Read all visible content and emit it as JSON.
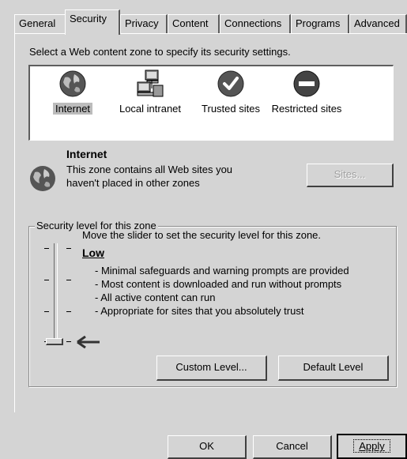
{
  "tabs": [
    "General",
    "Security",
    "Privacy",
    "Content",
    "Connections",
    "Programs",
    "Advanced"
  ],
  "active_tab": "Security",
  "zone_prompt": "Select a Web content zone to specify its security settings.",
  "zones": [
    {
      "label": "Internet",
      "icon": "globe-icon",
      "selected": true
    },
    {
      "label": "Local intranet",
      "icon": "intranet-computers-icon",
      "selected": false
    },
    {
      "label": "Trusted sites",
      "icon": "checkmark-icon",
      "selected": false
    },
    {
      "label": "Restricted sites",
      "icon": "no-entry-icon",
      "selected": false
    }
  ],
  "zone_info": {
    "title": "Internet",
    "description_line1": "This zone contains all Web sites you",
    "description_line2": "haven't placed in other zones",
    "sites_button": "Sites..."
  },
  "security_level": {
    "group_label": "Security level for this zone",
    "instruction": "Move the slider to set the security level for this zone.",
    "level_name": "Low",
    "bullets": [
      "- Minimal safeguards and warning prompts are provided",
      "- Most content is downloaded and run without prompts",
      "- All active content can run",
      "- Appropriate for sites that you absolutely trust"
    ],
    "custom_level_button": "Custom Level...",
    "default_level_button": "Default Level"
  },
  "dialog_buttons": {
    "ok": "OK",
    "cancel": "Cancel",
    "apply": "Apply"
  }
}
